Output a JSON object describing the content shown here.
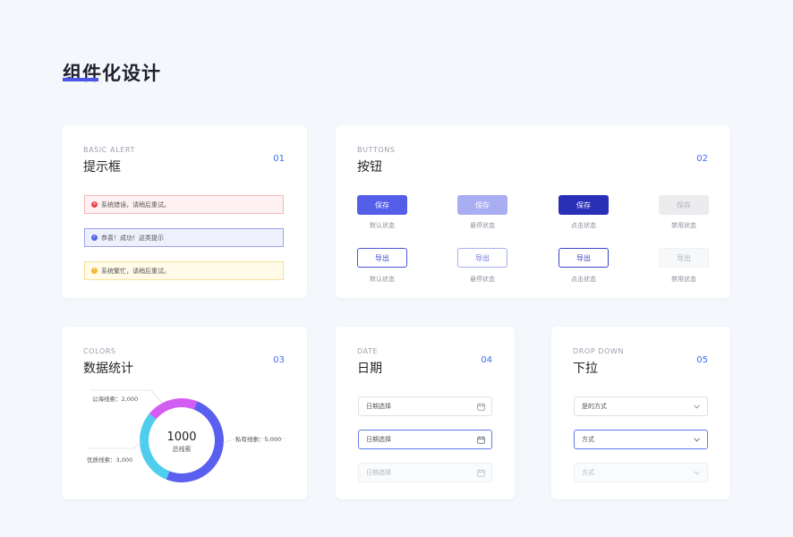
{
  "page": {
    "title": "组件化设计"
  },
  "alert_card": {
    "tag": "BASIC ALERT",
    "title": "提示框",
    "number": "01",
    "alerts": [
      {
        "type": "error",
        "text": "系统错误，请稍后重试。",
        "icon": "close-circle-icon",
        "color": "#e8424a"
      },
      {
        "type": "success",
        "text": "恭喜！成功！这类提示",
        "icon": "check-circle-icon",
        "color": "#5563e8"
      },
      {
        "type": "warning",
        "text": "系统繁忙，请稍后重试。",
        "icon": "warning-circle-icon",
        "color": "#f5b82b"
      }
    ]
  },
  "buttons_card": {
    "tag": "BUTTONS",
    "title": "按钮",
    "number": "02",
    "filled": [
      {
        "label": "保存",
        "state": "默认状态"
      },
      {
        "label": "保存",
        "state": "悬停状态"
      },
      {
        "label": "保存",
        "state": "点击状态"
      },
      {
        "label": "保存",
        "state": "禁用状态"
      }
    ],
    "outlined": [
      {
        "label": "导出",
        "state": "默认状态"
      },
      {
        "label": "导出",
        "state": "悬停状态"
      },
      {
        "label": "导出",
        "state": "点击状态"
      },
      {
        "label": "导出",
        "state": "禁用状态"
      }
    ]
  },
  "colors_card": {
    "tag": "COLORS",
    "title": "数据统计",
    "number": "03"
  },
  "chart_data": {
    "type": "pie",
    "donut": true,
    "center_value": "1000",
    "center_label": "总线索",
    "segments": [
      {
        "label": "私有线索：5,000",
        "value": 5000,
        "color": "#5a5ff0"
      },
      {
        "label": "优质线索：3,000",
        "value": 3000,
        "color": "#4fcdec"
      },
      {
        "label": "公海线索：2,000",
        "value": 2000,
        "color": "#d35df3"
      }
    ]
  },
  "date_card": {
    "tag": "DATE",
    "title": "日期",
    "number": "04",
    "fields": [
      {
        "text": "日期选择",
        "state": "default"
      },
      {
        "text": "日期选择",
        "state": "focus"
      },
      {
        "text": "日期选择",
        "state": "disabled"
      }
    ]
  },
  "dropdown_card": {
    "tag": "DROP DOWN",
    "title": "下拉",
    "number": "05",
    "fields": [
      {
        "text": "是的方式",
        "state": "default"
      },
      {
        "text": "方式",
        "state": "focus"
      },
      {
        "text": "方式",
        "state": "disabled"
      }
    ]
  },
  "colors": {
    "accent": "#4b55e8",
    "number": "#3c6cf0"
  }
}
